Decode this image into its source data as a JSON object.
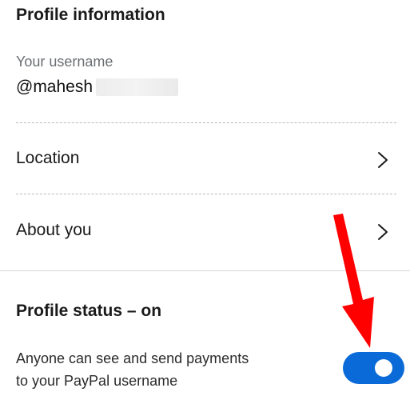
{
  "profile": {
    "section_title": "Profile information",
    "username_label": "Your username",
    "username_value": "@mahesh"
  },
  "rows": {
    "location_label": "Location",
    "about_label": "About you",
    "chevron_icon": "chevron-right-icon"
  },
  "status": {
    "title": "Profile status – on",
    "description_line1": "Anyone can see and send payments",
    "description_line2": "to your PayPal username",
    "toggle_state": "on"
  },
  "annotation": {
    "arrow_icon": "arrow-down-icon"
  },
  "colors": {
    "toggle_on": "#0a6ad7",
    "annotation_arrow": "#ff0000",
    "divider_dashed": "#b9b9b9",
    "muted_text": "#6b6f73"
  }
}
